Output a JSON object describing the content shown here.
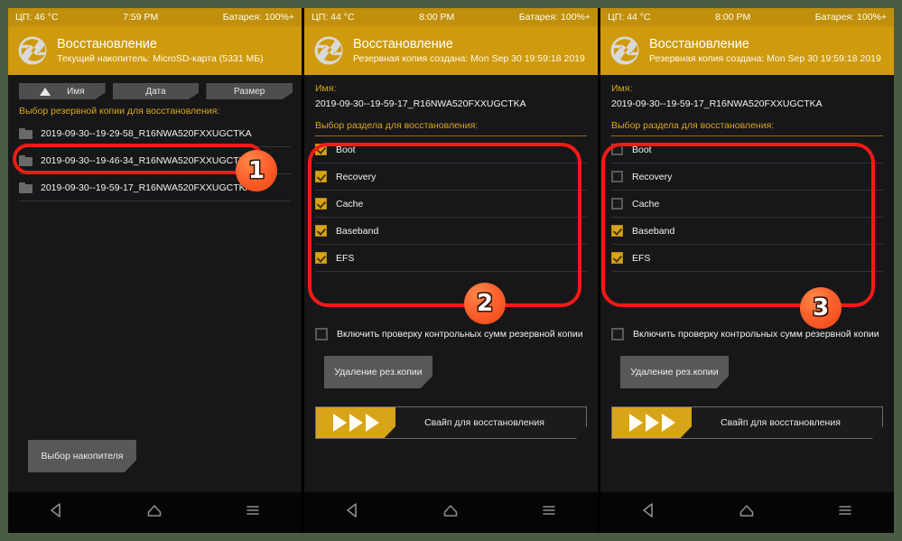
{
  "meta": {
    "accent_gold": "#cf9a0d",
    "statusbar_gold": "#c08f0c",
    "checkbox_gold": "#d8a418",
    "annotation_red": "#f41a16",
    "badge_orange": "#fb6430",
    "screen_bg": "#17171a"
  },
  "panels": [
    {
      "id": "panel-1",
      "statusbar": {
        "cpu": "ЦП: 46 °C",
        "time": "7:59 PM",
        "battery": "Батарея: 100%+"
      },
      "header": {
        "title": "Восстановление",
        "subtitle": "Текущий накопитель: MicroSD-карта (5331 МБ)",
        "logo_icon": "twrp-logo-icon"
      },
      "sort_buttons": [
        {
          "label": "Имя",
          "icon": "sort-ascending-icon",
          "active": true
        },
        {
          "label": "Дата",
          "icon": "",
          "active": false
        },
        {
          "label": "Размер",
          "icon": "",
          "active": false
        }
      ],
      "list_label": "Выбор резервной копии для восстановления:",
      "backups": [
        "2019-09-30--19-29-58_R16NWA520FXXUGCTKA",
        "2019-09-30--19-46-34_R16NWA520FXXUGCTKA",
        "2019-09-30--19-59-17_R16NWA520FXXUGCTKA"
      ],
      "storage_button": "Выбор накопителя"
    },
    {
      "id": "panel-2",
      "statusbar": {
        "cpu": "ЦП: 44 °C",
        "time": "8:00 PM",
        "battery": "Батарея: 100%+"
      },
      "header": {
        "title": "Восстановление",
        "subtitle": "Резервная копия создана: Mon Sep 30 19:59:18 2019",
        "logo_icon": "twrp-logo-icon"
      },
      "name_label": "Имя:",
      "name_value": "2019-09-30--19-59-17_R16NWA520FXXUGCTKA",
      "partitions_label": "Выбор раздела для восстановления:",
      "partitions": [
        {
          "label": "Boot",
          "checked": true
        },
        {
          "label": "Recovery",
          "checked": true
        },
        {
          "label": "Cache",
          "checked": true
        },
        {
          "label": "Baseband",
          "checked": true
        },
        {
          "label": "EFS",
          "checked": true
        }
      ],
      "md5_label": "Включить проверку контрольных сумм резервной копии",
      "md5_checked": false,
      "delete_button": "Удаление рез.копии",
      "swipe_text": "Свайп для восстановления"
    },
    {
      "id": "panel-3",
      "statusbar": {
        "cpu": "ЦП: 44 °C",
        "time": "8:00 PM",
        "battery": "Батарея: 100%+"
      },
      "header": {
        "title": "Восстановление",
        "subtitle": "Резервная копия создана: Mon Sep 30 19:59:18 2019",
        "logo_icon": "twrp-logo-icon"
      },
      "name_label": "Имя:",
      "name_value": "2019-09-30--19-59-17_R16NWA520FXXUGCTKA",
      "partitions_label": "Выбор раздела для восстановления:",
      "partitions": [
        {
          "label": "Boot",
          "checked": false
        },
        {
          "label": "Recovery",
          "checked": false
        },
        {
          "label": "Cache",
          "checked": false
        },
        {
          "label": "Baseband",
          "checked": true
        },
        {
          "label": "EFS",
          "checked": true
        }
      ],
      "md5_label": "Включить проверку контрольных сумм резервной копии",
      "md5_checked": false,
      "delete_button": "Удаление рез.копии",
      "swipe_text": "Свайп для восстановления"
    }
  ],
  "navbar": {
    "back_icon": "back-triangle-icon",
    "home_icon": "home-icon",
    "menu_icon": "menu-lines-icon"
  },
  "annotations": [
    {
      "badge": "1"
    },
    {
      "badge": "2"
    },
    {
      "badge": "3"
    }
  ]
}
